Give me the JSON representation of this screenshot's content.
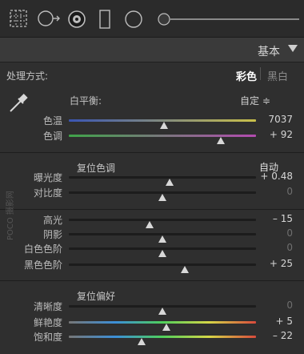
{
  "header": {
    "title": "基本"
  },
  "treatment": {
    "label": "处理方式:",
    "color": "彩色",
    "bw": "黑白"
  },
  "white_balance": {
    "title": "白平衡:",
    "value": "自定 ≑"
  },
  "tone": {
    "reset_label": "复位色调",
    "auto_label": "自动"
  },
  "presence": {
    "reset_label": "复位偏好"
  },
  "watermark": {
    "text": "POCO 摄影网"
  },
  "sliders": [
    {
      "label": "色温",
      "value": "7037",
      "position": 0.51,
      "gradient": "linear-gradient(90deg,#3a55b3,#c9c04a)"
    },
    {
      "label": "色调",
      "value": "+ 92",
      "position": 0.81,
      "gradient": "linear-gradient(90deg,#3fa349,#b34bb0)"
    },
    {
      "label": "曝光度",
      "value": "+ 0.48",
      "position": 0.54
    },
    {
      "label": "对比度",
      "value": "0",
      "position": 0.5
    },
    {
      "label": "高光",
      "value": "– 15",
      "position": 0.43
    },
    {
      "label": "阴影",
      "value": "0",
      "position": 0.5
    },
    {
      "label": "白色色阶",
      "value": "0",
      "position": 0.5
    },
    {
      "label": "黑色色阶",
      "value": "+ 25",
      "position": 0.62
    },
    {
      "label": "清晰度",
      "value": "0",
      "position": 0.5
    },
    {
      "label": "鲜艳度",
      "value": "+ 5",
      "position": 0.52,
      "gradient": "linear-gradient(90deg,#777,#3c8fd8,#4fd05b,#d6d647,#d84a3c)"
    },
    {
      "label": "饱和度",
      "value": "– 22",
      "position": 0.39,
      "gradient": "linear-gradient(90deg,#777,#3c8fd8,#4fd05b,#d6d647,#d84a3c)"
    }
  ]
}
